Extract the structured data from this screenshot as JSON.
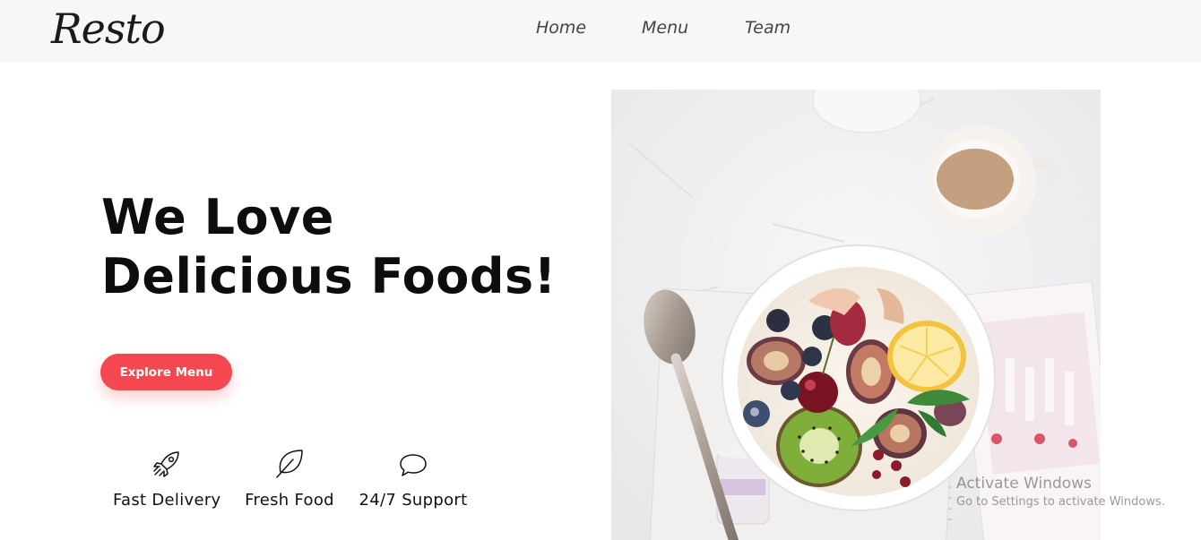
{
  "brand": {
    "logo_text": "Resto"
  },
  "nav": {
    "items": [
      "Home",
      "Menu",
      "Team"
    ]
  },
  "hero": {
    "title_line1": "We Love",
    "title_line2": "Delicious Foods!",
    "cta_label": "Explore Menu",
    "cta_color": "#f5474f",
    "image_alt": "bowl of yogurt with figs, kiwi, lemon, berries, spoon and coffee cup"
  },
  "features": [
    {
      "icon": "rocket-icon",
      "label": "Fast Delivery"
    },
    {
      "icon": "leaf-icon",
      "label": "Fresh Food"
    },
    {
      "icon": "chat-bubble-icon",
      "label": "24/7 Support"
    }
  ],
  "watermark": {
    "line1": "Activate Windows",
    "line2": "Go to Settings to activate Windows."
  }
}
